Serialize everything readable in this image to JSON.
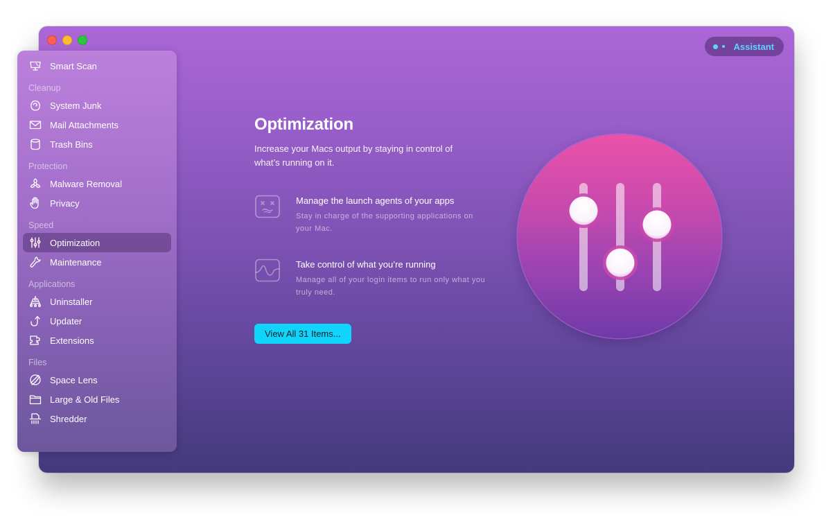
{
  "window": {
    "traffic_lights": [
      "close",
      "minimize",
      "maximize"
    ],
    "assistant": {
      "label": "Assistant",
      "icon": "assistant-dots-icon",
      "color": "#5fd3ff"
    }
  },
  "sidebar": {
    "items": [
      {
        "type": "item",
        "label": "Smart Scan",
        "icon": "monitor-icon"
      },
      {
        "type": "section",
        "label": "Cleanup"
      },
      {
        "type": "item",
        "label": "System Junk",
        "icon": "system-junk-icon"
      },
      {
        "type": "item",
        "label": "Mail Attachments",
        "icon": "envelope-icon"
      },
      {
        "type": "item",
        "label": "Trash Bins",
        "icon": "trash-bin-icon"
      },
      {
        "type": "section",
        "label": "Protection"
      },
      {
        "type": "item",
        "label": "Malware Removal",
        "icon": "biohazard-icon"
      },
      {
        "type": "item",
        "label": "Privacy",
        "icon": "hand-icon"
      },
      {
        "type": "section",
        "label": "Speed"
      },
      {
        "type": "item",
        "label": "Optimization",
        "icon": "sliders-icon",
        "active": true
      },
      {
        "type": "item",
        "label": "Maintenance",
        "icon": "wrench-icon"
      },
      {
        "type": "section",
        "label": "Applications"
      },
      {
        "type": "item",
        "label": "Uninstaller",
        "icon": "uninstaller-icon"
      },
      {
        "type": "item",
        "label": "Updater",
        "icon": "update-arrow-icon"
      },
      {
        "type": "item",
        "label": "Extensions",
        "icon": "puzzle-icon"
      },
      {
        "type": "section",
        "label": "Files"
      },
      {
        "type": "item",
        "label": "Space Lens",
        "icon": "space-lens-icon"
      },
      {
        "type": "item",
        "label": "Large & Old Files",
        "icon": "folder-icon"
      },
      {
        "type": "item",
        "label": "Shredder",
        "icon": "shredder-icon"
      }
    ]
  },
  "main": {
    "title": "Optimization",
    "subtitle": "Increase your Macs output by staying in control of what’s running on it.",
    "features": [
      {
        "icon": "dead-face-icon",
        "title": "Manage the launch agents of your apps",
        "description": "Stay in charge of the supporting applications on your Mac."
      },
      {
        "icon": "waveform-icon",
        "title": "Take control of what you’re running",
        "description": "Manage all of your login items to run only what you truly need."
      }
    ],
    "view_button": "View All 31 Items...",
    "accent_color": "#11d4fa",
    "hero_icon": "optimization-sliders-icon"
  }
}
